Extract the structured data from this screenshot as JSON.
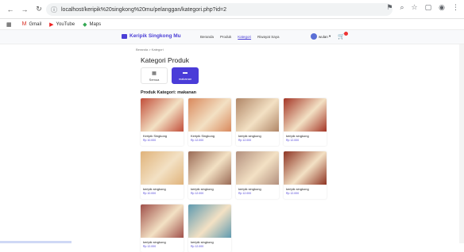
{
  "browser": {
    "url": "localhost/keripik%20singkong%20mu/pelanggan/kategori.php?id=2"
  },
  "bookmarks": [
    {
      "label": "Gmail"
    },
    {
      "label": "YouTube"
    },
    {
      "label": "Maps"
    }
  ],
  "nav": {
    "brand": "Keripik Singkong Mu",
    "links": [
      "Beranda",
      "Produk",
      "Kategori",
      "Riwayat Saya"
    ],
    "user": "wulan"
  },
  "breadcrumb": "Beranda > Kategori",
  "page_title": "Kategori Produk",
  "categories": [
    {
      "label": "Semua",
      "icon": "grid-icon"
    },
    {
      "label": "makanan",
      "icon": "folder-icon"
    }
  ],
  "section_title": "Produk Kategori: makanan",
  "products": [
    {
      "name": "Keripik Singkong",
      "price": "Rp 10.000",
      "color": "#c24e3a"
    },
    {
      "name": "Keripik Singkong",
      "price": "Rp 12.000",
      "color": "#d9895d"
    },
    {
      "name": "keripik singkong",
      "price": "Rp 12.000",
      "color": "#b08667"
    },
    {
      "name": "keripik singkong",
      "price": "Rp 12.000",
      "color": "#a43526"
    },
    {
      "name": "keripik singkong",
      "price": "Rp 10.000",
      "color": "#e0b37b"
    },
    {
      "name": "keripik singkong",
      "price": "Rp 12.000",
      "color": "#9a6a55"
    },
    {
      "name": "keripik singkong",
      "price": "Rp 12.000",
      "color": "#b3907e"
    },
    {
      "name": "keripik singkong",
      "price": "Rp 12.000",
      "color": "#8e3423"
    },
    {
      "name": "keripik singkong",
      "price": "Rp 12.000",
      "color": "#a0504a"
    },
    {
      "name": "keripik singkong",
      "price": "Rp 12.000",
      "color": "#5e9ab0"
    }
  ]
}
